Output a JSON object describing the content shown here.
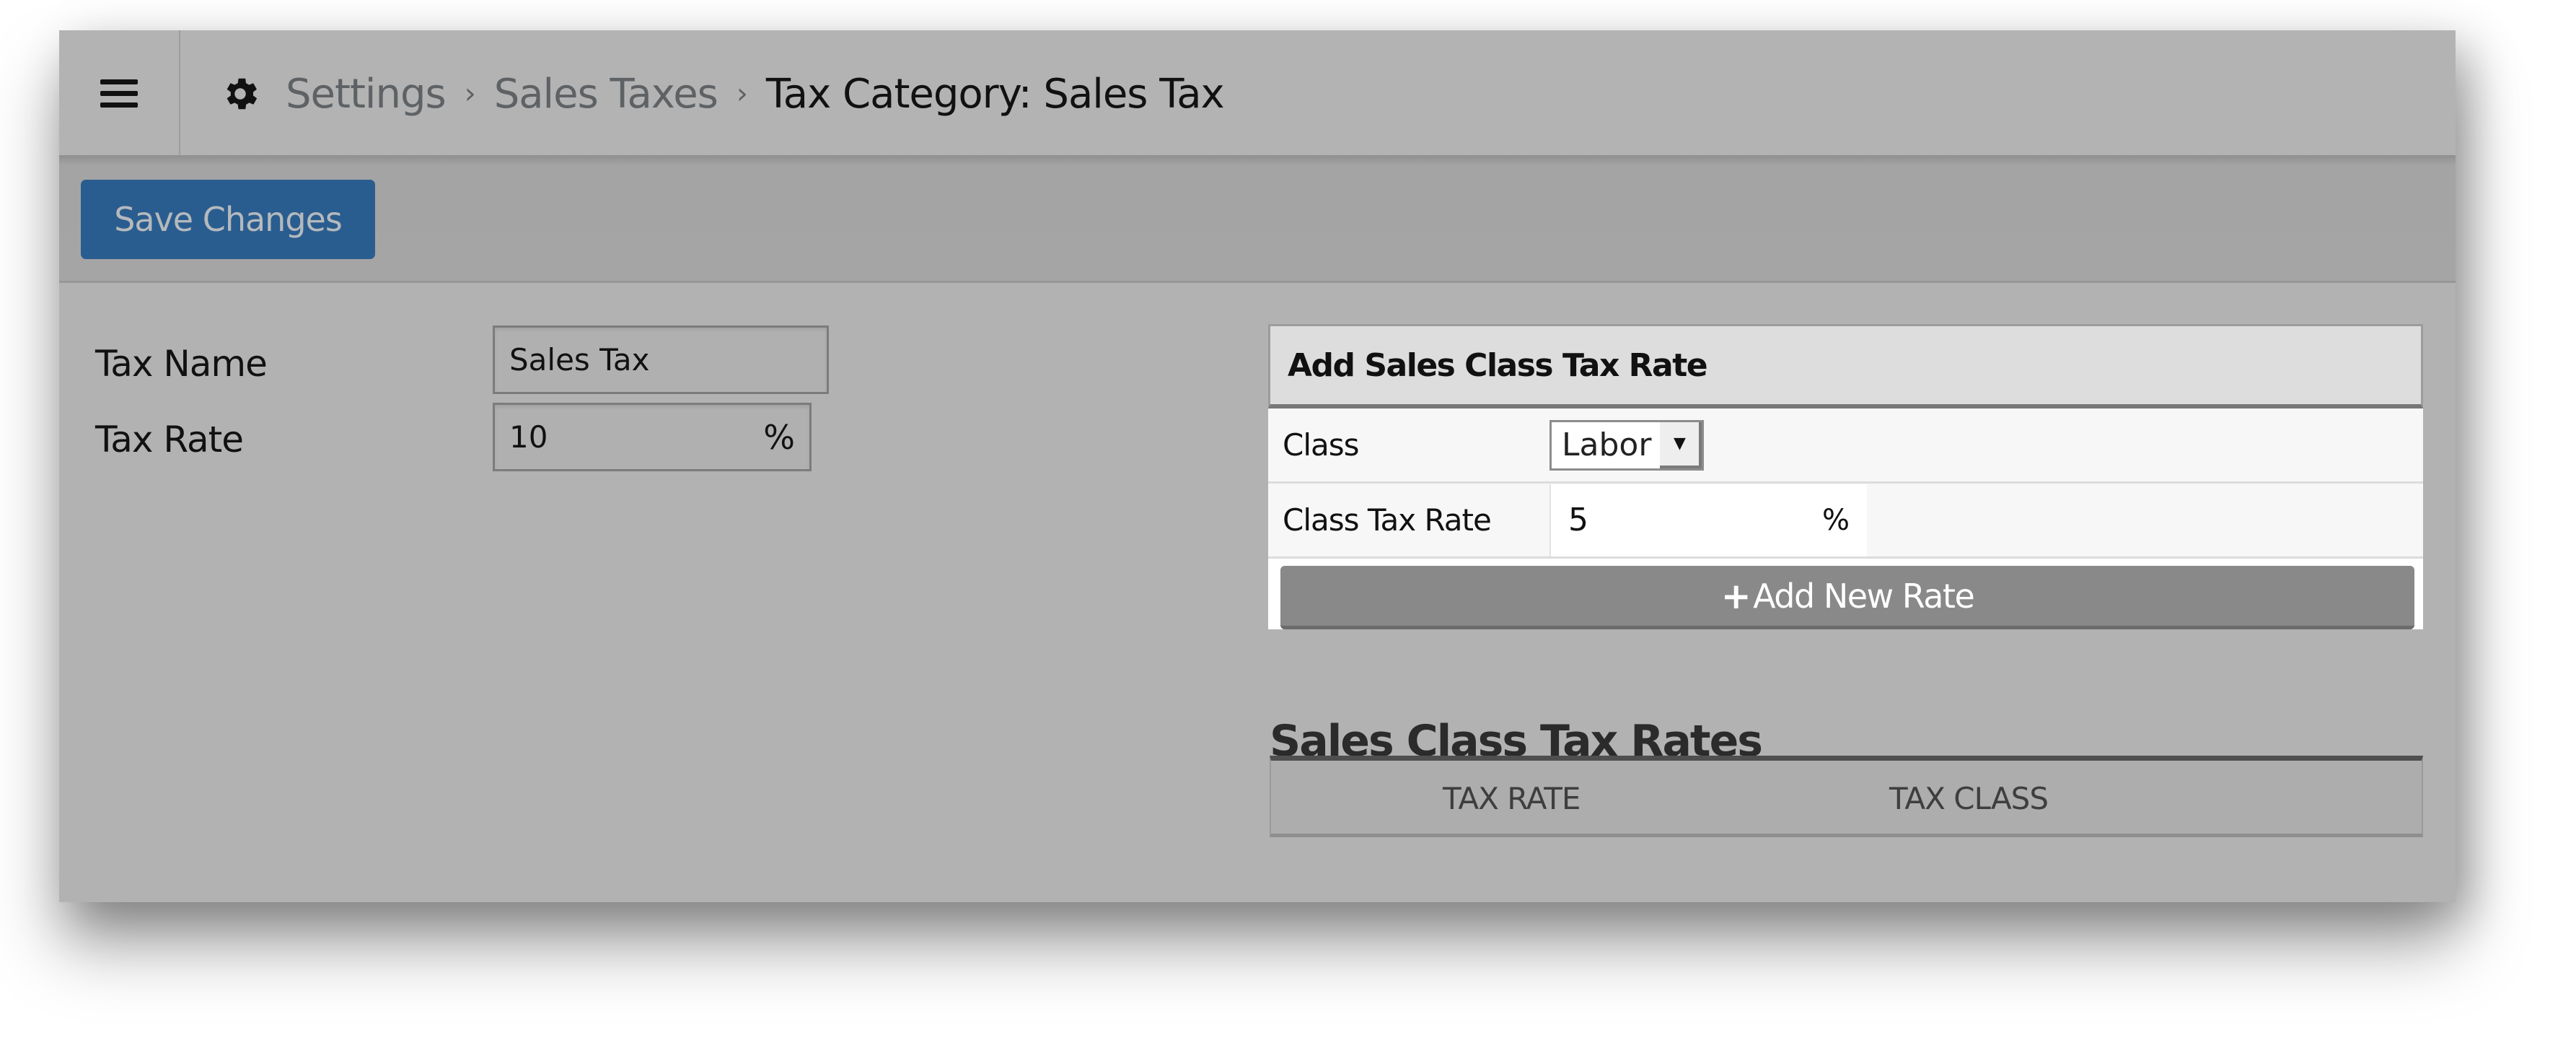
{
  "header": {
    "menu_icon": "hamburger-icon",
    "settings_icon": "gear-icon",
    "breadcrumb": [
      {
        "label": "Settings"
      },
      {
        "label": "Sales Taxes"
      },
      {
        "label": "Tax Category: Sales Tax"
      }
    ],
    "separator": "›"
  },
  "toolbar": {
    "save_label": "Save Changes",
    "save_color": "#2a5d8f"
  },
  "form": {
    "tax_name_label": "Tax Name",
    "tax_name_value": "Sales Tax",
    "tax_rate_label": "Tax Rate",
    "tax_rate_value": "10",
    "tax_rate_suffix": "%"
  },
  "add_panel": {
    "title": "Add Sales Class Tax Rate",
    "class_label": "Class",
    "class_selected": "Labor",
    "class_tax_rate_label": "Class Tax Rate",
    "class_tax_rate_value": "5",
    "class_tax_rate_suffix": "%",
    "add_button_icon": "plus-icon",
    "add_button_label": "Add New Rate"
  },
  "rates_table": {
    "title": "Sales Class Tax Rates",
    "columns": [
      "TAX RATE",
      "TAX CLASS"
    ],
    "rows": []
  }
}
